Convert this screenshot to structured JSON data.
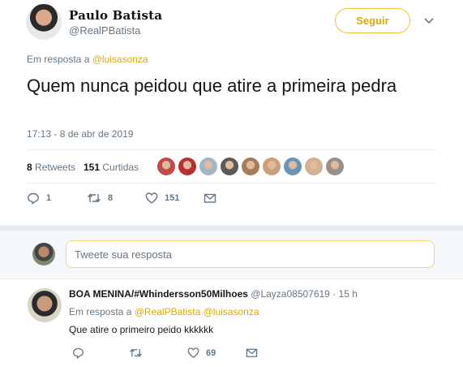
{
  "tweet": {
    "author_name": "Paulo Batista",
    "author_handle": "@RealPBatista",
    "follow_label": "Seguir",
    "reply_prefix": "Em resposta a ",
    "reply_to": "@luisasonza",
    "text": "Quem nunca peidou que atire a primeira pedra",
    "timestamp": "17:13 - 8 de abr de 2019",
    "retweets_count": "8",
    "retweets_label": "Retweets",
    "likes_count": "151",
    "likes_label": "Curtidas",
    "actions": {
      "reply_count": "1",
      "retweet_count": "8",
      "like_count": "151"
    }
  },
  "liker_avatar_colors": [
    "#c44a4a",
    "#b8302e",
    "#9fb7c6",
    "#5a5a5a",
    "#a77b5c",
    "#c9a07a",
    "#6a94b8",
    "#d2b28f",
    "#9a8f86"
  ],
  "composer": {
    "placeholder": "Tweete sua resposta"
  },
  "reply": {
    "author_name": "BOA MENINA/#Whindersson50Milhoes",
    "author_handle": "@Layza08507619",
    "separator": " · ",
    "time": "15 h",
    "reply_prefix": "Em resposta a ",
    "reply_to_1": "@RealPBatista",
    "reply_to_2": "@luisasonza",
    "text": "Que atire o primeiro peido kkkkkk",
    "like_count": "69"
  },
  "colors": {
    "accent": "#e0a800",
    "text_secondary": "#657786",
    "border": "#e6ecf0"
  }
}
